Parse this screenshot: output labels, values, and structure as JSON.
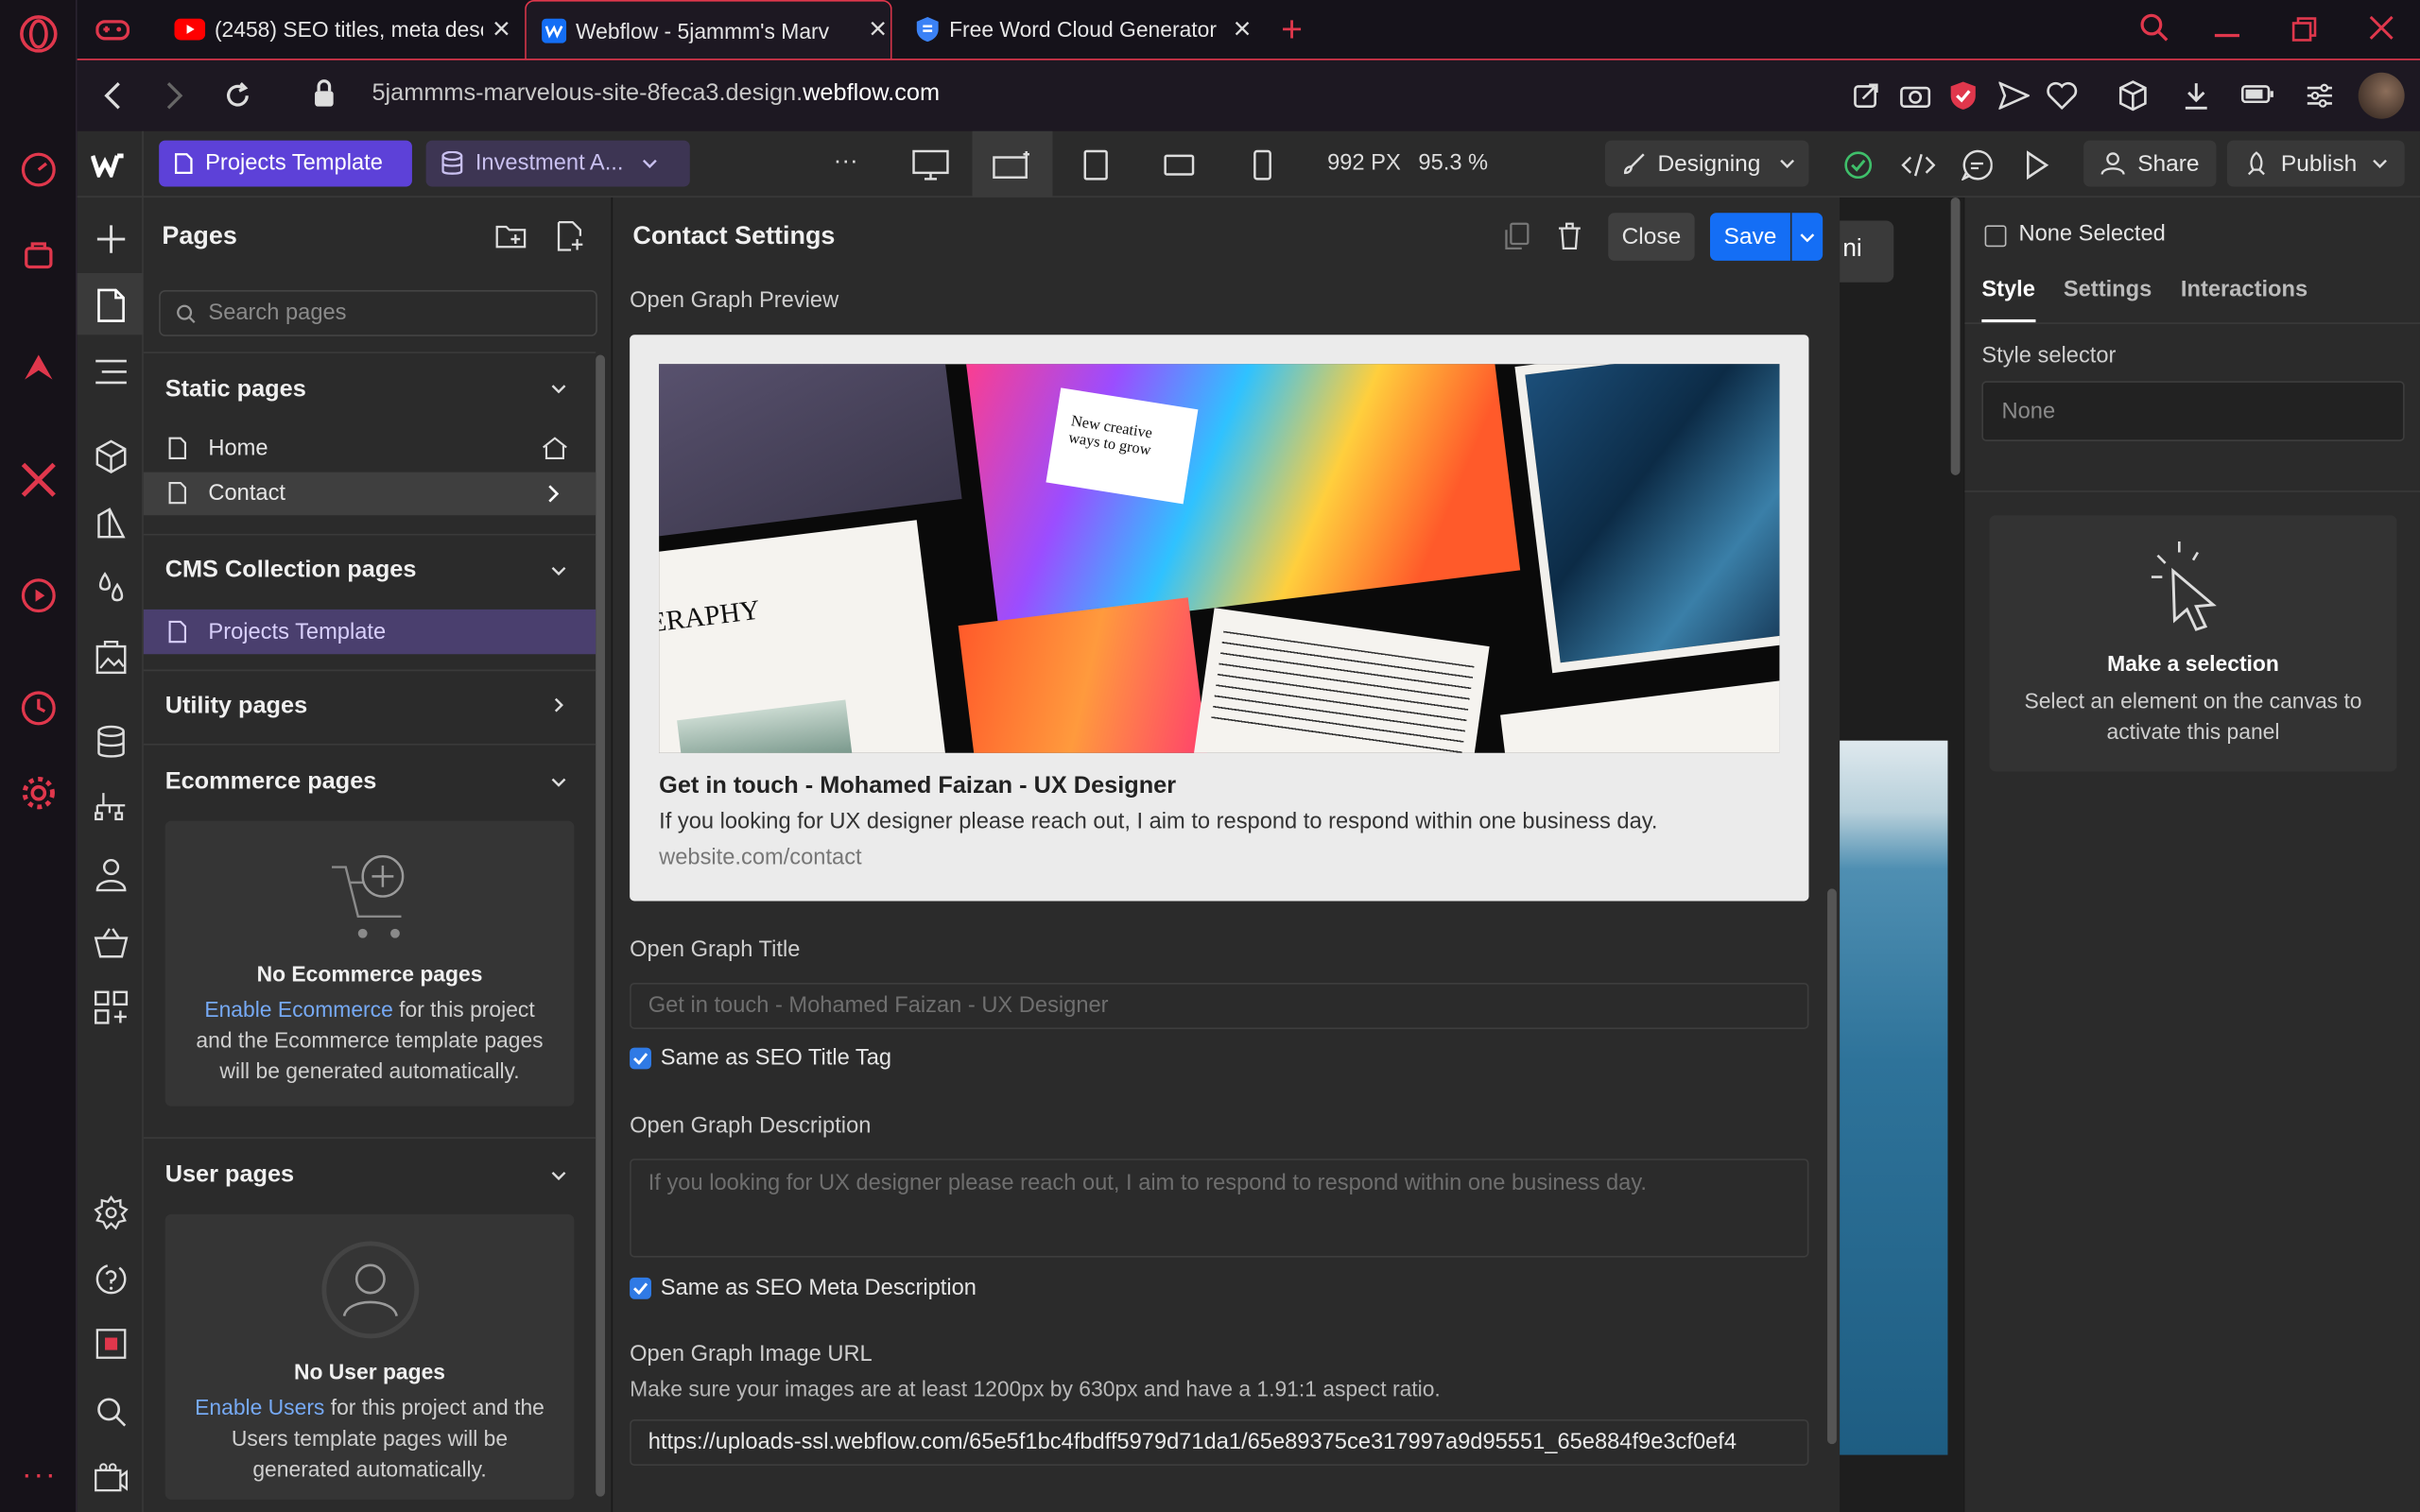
{
  "browser": {
    "tabs": [
      {
        "title": "(2458) SEO titles, meta desc",
        "icon": "youtube-icon"
      },
      {
        "title": "Webflow - 5jammm's Marv",
        "icon": "webflow-icon"
      },
      {
        "title": "Free Word Cloud Generator",
        "icon": "shield-icon"
      }
    ],
    "url_prefix": "5jammms-marvelous-site-8feca3.design.",
    "url_domain": "webflow.com"
  },
  "toolbar": {
    "page_name": "Projects Template",
    "collection": "Investment A...",
    "more": "···",
    "width": "992 PX",
    "zoom": "95.3 %",
    "mode": "Designing",
    "share": "Share",
    "publish": "Publish"
  },
  "pages_panel": {
    "title": "Pages",
    "search_placeholder": "Search pages",
    "static_title": "Static pages",
    "static_items": [
      "Home",
      "Contact"
    ],
    "cms_title": "CMS Collection pages",
    "cms_items": [
      "Projects Template"
    ],
    "utility_title": "Utility pages",
    "ecommerce_title": "Ecommerce pages",
    "ecommerce_empty_title": "No Ecommerce pages",
    "ecommerce_link": "Enable Ecommerce",
    "ecommerce_desc1": " for this project",
    "ecommerce_desc2": "and the Ecommerce template pages",
    "ecommerce_desc3": "will be generated automatically.",
    "user_title": "User pages",
    "user_empty_title": "No User pages",
    "user_link": "Enable Users",
    "user_desc1": " for this project and the",
    "user_desc2": "Users template pages will be",
    "user_desc3": "generated automatically."
  },
  "contact_settings": {
    "title": "Contact Settings",
    "close": "Close",
    "save": "Save",
    "og_preview_label": "Open Graph Preview",
    "preview_image_text": "New creative ways to grow",
    "preview_image_heading": "ERAPHY",
    "preview_title": "Get in touch - Mohamed Faizan - UX Designer",
    "preview_desc": "If you looking for UX designer please reach out, I aim to respond to respond within one business day.",
    "preview_url": "website.com/contact",
    "og_title_label": "Open Graph Title",
    "og_title_placeholder": "Get in touch - Mohamed Faizan - UX Designer",
    "same_title": "Same as SEO Title Tag",
    "og_desc_label": "Open Graph Description",
    "og_desc_placeholder": "If you looking for UX designer please reach out, I aim to respond to respond within one business day.",
    "same_desc": "Same as SEO Meta Description",
    "og_image_label": "Open Graph Image URL",
    "og_image_hint": "Make sure your images are at least 1200px by 630px and have a 1.91:1 aspect ratio.",
    "og_image_url": "https://uploads-ssl.webflow.com/65e5f1bc4fbdff5979d71da1/65e89375ce317997a9d95551_65e884f9e3cf0ef4"
  },
  "canvas": {
    "partial_text": "ni"
  },
  "right_panel": {
    "none_selected": "None Selected",
    "tabs": [
      "Style",
      "Settings",
      "Interactions"
    ],
    "style_selector": "Style selector",
    "selector_placeholder": "None",
    "make_selection": "Make a selection",
    "hint1": "Select an element on the canvas to",
    "hint2": "activate this panel"
  },
  "colors": {
    "accent": "#e0374c",
    "webflow_purple": "#5d41d8",
    "save_blue": "#146ef5",
    "link_blue": "#76a9f4"
  }
}
